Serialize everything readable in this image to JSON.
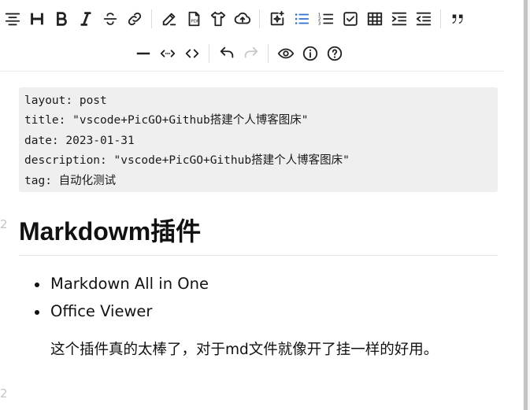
{
  "toolbar": {
    "row1": [
      {
        "name": "align-icon"
      },
      {
        "name": "heading-icon"
      },
      {
        "name": "bold-icon"
      },
      {
        "name": "italic-icon"
      },
      {
        "name": "strikethrough-icon"
      },
      {
        "name": "link-icon"
      },
      {
        "sep": true
      },
      {
        "name": "edit-icon"
      },
      {
        "name": "pdf-icon"
      },
      {
        "name": "shirt-icon"
      },
      {
        "name": "cloud-upload-icon"
      },
      {
        "sep": true
      },
      {
        "name": "add-image-icon"
      },
      {
        "name": "bullet-list-icon",
        "active": true
      },
      {
        "name": "numbered-list-icon"
      },
      {
        "name": "checkbox-icon"
      },
      {
        "name": "table-icon"
      },
      {
        "name": "indent-icon"
      },
      {
        "name": "outdent-icon"
      },
      {
        "sep": true
      },
      {
        "name": "quote-icon"
      }
    ],
    "row2": [
      {
        "name": "horizontal-rule-icon"
      },
      {
        "name": "inline-code-icon"
      },
      {
        "name": "code-block-icon"
      },
      {
        "sep": true
      },
      {
        "name": "undo-icon"
      },
      {
        "name": "redo-icon",
        "disabled": true
      },
      {
        "sep": true
      },
      {
        "name": "preview-eye-icon"
      },
      {
        "name": "info-icon"
      },
      {
        "name": "help-icon"
      }
    ],
    "active_color": "#2f6fd1"
  },
  "front_matter": [
    "layout: post",
    "title: \"vscode+PicGO+Github搭建个人博客图床\"",
    "date: 2023-01-31",
    "description: \"vscode+PicGO+Github搭建个人博客图床\"",
    "tag: 自动化测试"
  ],
  "gutter": {
    "heading_line": "2",
    "bottom_line": "2"
  },
  "heading": "Markdowm插件",
  "bullets": [
    "Markdown All in One",
    "Office Viewer"
  ],
  "paragraph": "这个插件真的太棒了，对于md文件就像开了挂一样的好用。"
}
